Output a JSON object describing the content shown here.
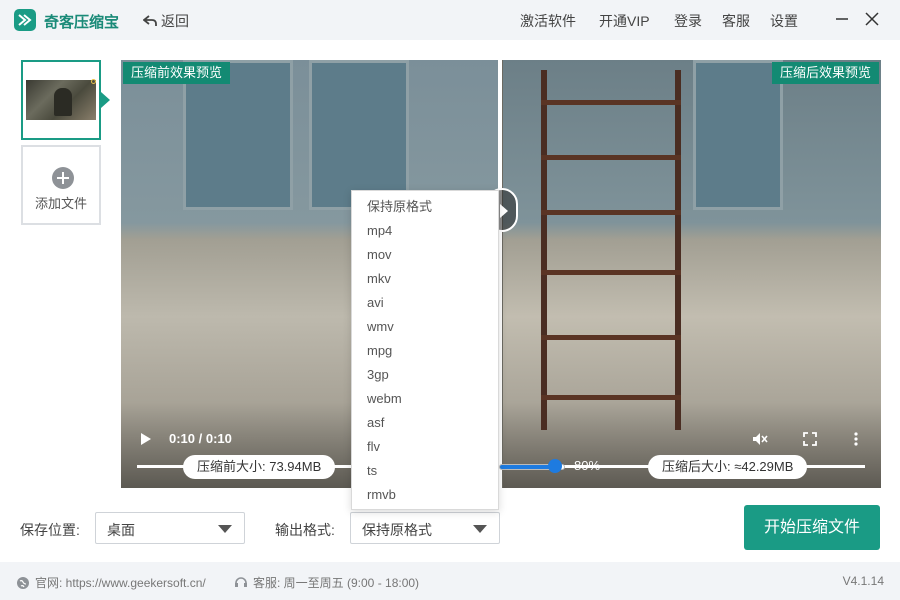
{
  "titlebar": {
    "app_title": "奇客压缩宝",
    "back_label": "返回",
    "menu": [
      "激活软件",
      "开通VIP",
      "登录",
      "客服",
      "设置"
    ]
  },
  "sidebar": {
    "add_label": "添加文件"
  },
  "preview": {
    "before_tag": "压缩前效果预览",
    "after_tag": "压缩后效果预览",
    "timecode": "0:10 / 0:10",
    "before_size": "压缩前大小: 73.94MB",
    "after_size": "压缩后大小: ≈42.29MB",
    "ratio_text": "80%",
    "ratio_value": 0.8
  },
  "format_dropdown": {
    "options": [
      "保持原格式",
      "mp4",
      "mov",
      "mkv",
      "avi",
      "wmv",
      "mpg",
      "3gp",
      "webm",
      "asf",
      "flv",
      "ts",
      "rmvb"
    ]
  },
  "bottom": {
    "save_label": "保存位置:",
    "save_value": "桌面",
    "format_label": "输出格式:",
    "format_value": "保持原格式",
    "start_button": "开始压缩文件"
  },
  "footer": {
    "website": "官网: https://www.geekersoft.cn/",
    "support": "客服: 周一至周五 (9:00 - 18:00)",
    "version": "V4.1.14"
  },
  "colors": {
    "accent": "#1a9b85",
    "slider": "#1e7be0"
  }
}
